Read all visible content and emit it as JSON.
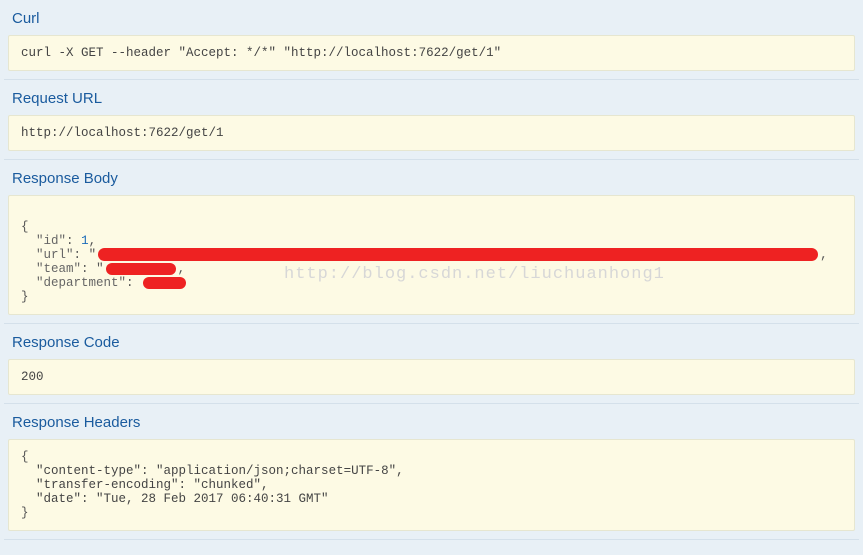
{
  "sections": {
    "curl": {
      "title": "Curl",
      "content": "curl -X GET --header \"Accept: */*\" \"http://localhost:7622/get/1\""
    },
    "request_url": {
      "title": "Request URL",
      "content": "http://localhost:7622/get/1"
    },
    "response_body": {
      "title": "Response Body",
      "id_value": "1"
    },
    "response_code": {
      "title": "Response Code",
      "content": "200"
    },
    "response_headers": {
      "title": "Response Headers",
      "content_type": "\"content-type\": \"application/json;charset=UTF-8\",",
      "transfer_encoding": "\"transfer-encoding\": \"chunked\",",
      "date": "\"date\": \"Tue, 28 Feb 2017 06:40:31 GMT\""
    }
  },
  "watermark": "http://blog.csdn.net/liuchuanhong1"
}
